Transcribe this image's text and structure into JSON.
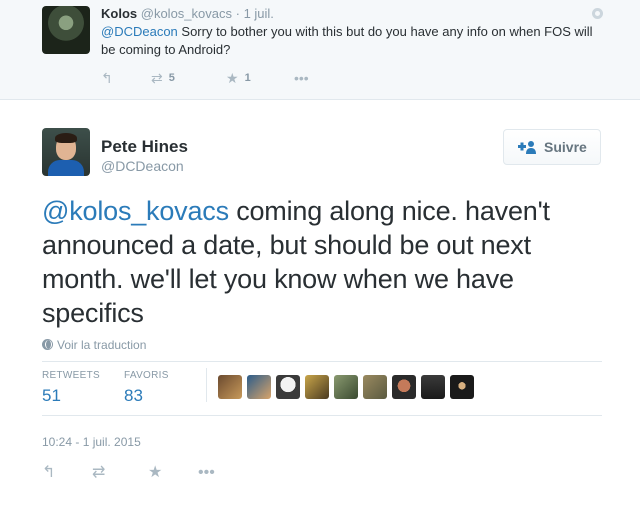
{
  "parent_tweet": {
    "name": "Kolos",
    "handle": "@kolos_kovacs",
    "time": "· 1 juil.",
    "mention": "@DCDeacon",
    "text": " Sorry to bother you with this but do you have any info on when FOS will be coming to Android?",
    "retweets": "5",
    "favorites": "1"
  },
  "main_tweet": {
    "name": "Pete Hines",
    "handle": "@DCDeacon",
    "follow_label": "Suivre",
    "mention": "@kolos_kovacs",
    "text": " coming along nice. haven't announced a date, but should be out next month. we'll let you know when we have specifics",
    "translate_label": "Voir la traduction",
    "retweets_label": "RETWEETS",
    "retweets_value": "51",
    "favorites_label": "FAVORIS",
    "favorites_value": "83",
    "timestamp": "10:24 - 1 juil. 2015"
  },
  "icons": [
    "reply-icon",
    "retweet-icon",
    "favorite-icon",
    "more-icon",
    "globe-icon",
    "follow-user-icon",
    "gear-icon"
  ],
  "colors": {
    "link": "#2b7bb9",
    "muted": "#8899a6",
    "text": "#292f33",
    "parent_bg": "#f5f8fa"
  }
}
